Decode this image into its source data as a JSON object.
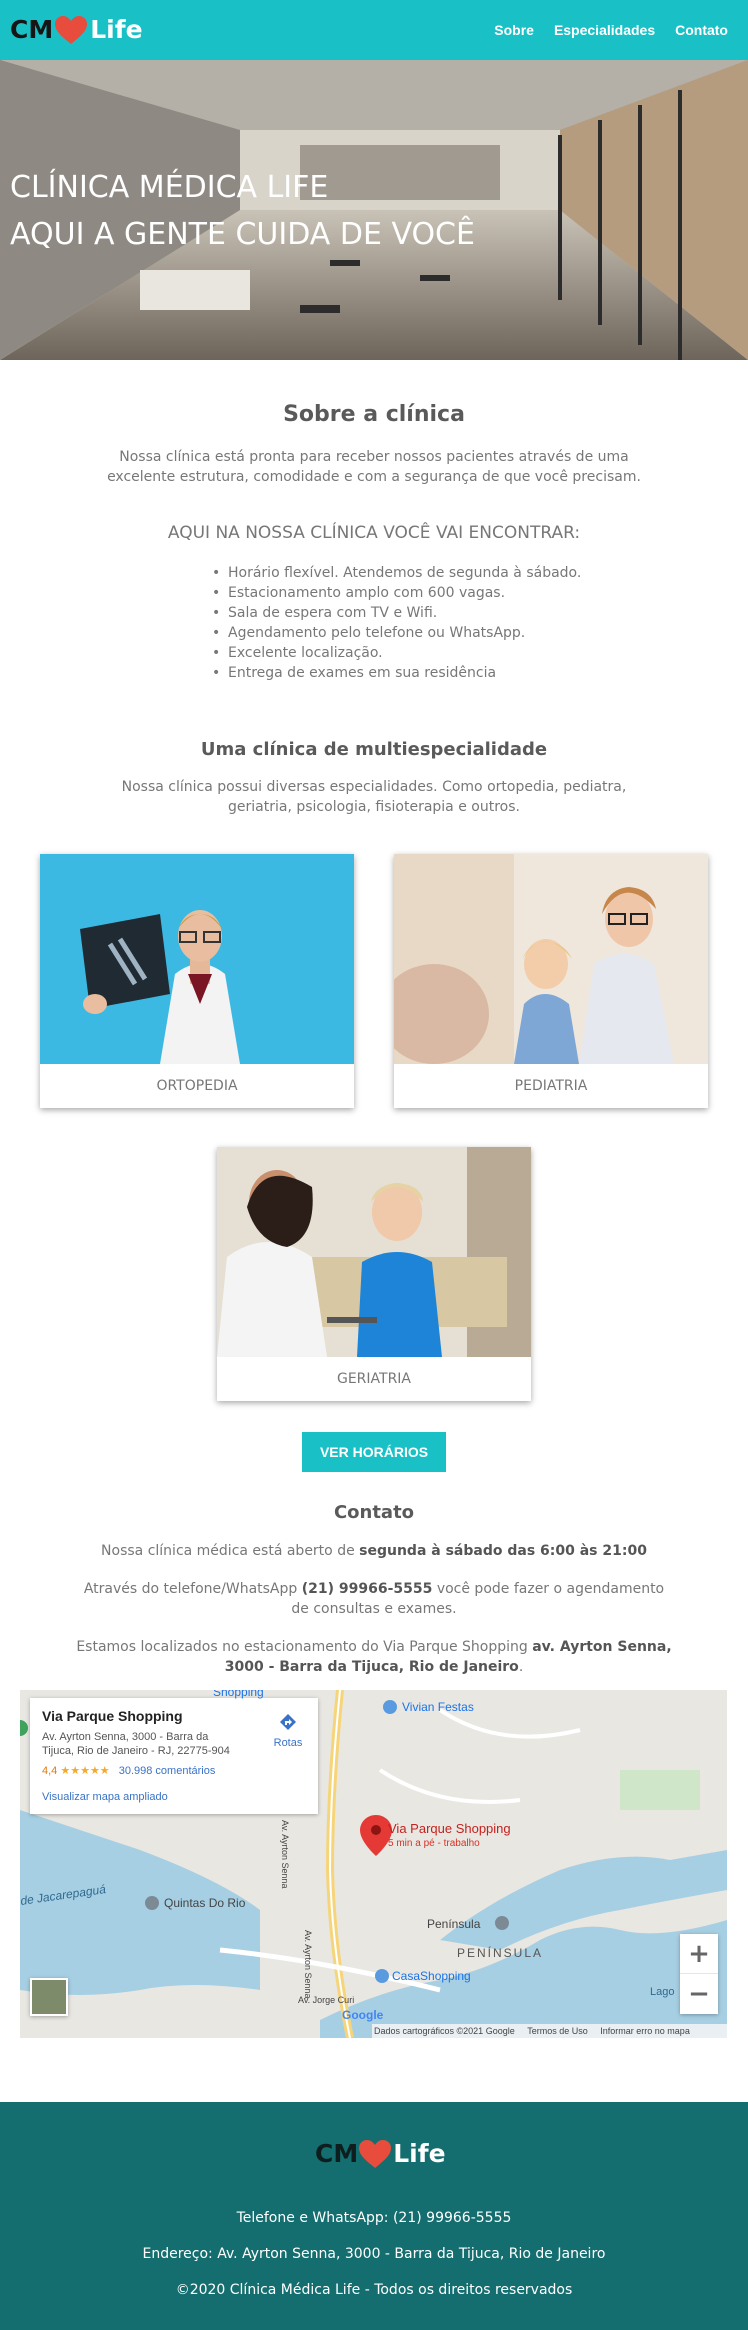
{
  "header": {
    "logo_cm": "CM",
    "logo_life": "Life",
    "nav": [
      "Sobre",
      "Especialidades",
      "Contato"
    ]
  },
  "hero": {
    "line1": "CLÍNICA MÉDICA LIFE",
    "line2": "AQUI A GENTE CUIDA DE VOCÊ"
  },
  "about": {
    "title": "Sobre a clínica",
    "text": "Nossa clínica está pronta para receber nossos pacientes através de uma excelente estrutura, comodidade e com a segurança de que você precisam.",
    "subtitle": "AQUI NA NOSSA CLÍNICA VOCÊ VAI ENCONTRAR:",
    "features": [
      "Horário flexível. Atendemos de segunda à sábado.",
      "Estacionamento amplo com 600 vagas.",
      "Sala de espera com TV e Wifi.",
      "Agendamento pelo telefone ou WhatsApp.",
      "Excelente localização.",
      "Entrega de exames em sua residência"
    ]
  },
  "specialties": {
    "title": "Uma clínica de multiespecialidade",
    "text": "Nossa clínica possui diversas especialidades. Como ortopedia, pediatra, geriatria, psicologia, fisioterapia e outros.",
    "cards": [
      "ORTOPEDIA",
      "PEDIATRIA",
      "GERIATRIA"
    ],
    "button": "VER HORÁRIOS"
  },
  "contact": {
    "title": "Contato",
    "hours_prefix": "Nossa clínica médica está aberto de ",
    "hours_bold": "segunda à sábado das 6:00 às 21:00",
    "phone_prefix": "Através do telefone/WhatsApp ",
    "phone_bold": "(21) 99966-5555",
    "phone_suffix": " você pode fazer o agendamento de consultas e exames.",
    "address_prefix": "Estamos localizados no estacionamento do Via Parque Shopping ",
    "address_bold": "av. Ayrton Senna, 3000 - Barra da Tijuca, Rio de Janeiro",
    "address_suffix": "."
  },
  "map": {
    "place_name": "Via Parque Shopping",
    "place_address": "Av. Ayrton Senna, 3000 - Barra da Tijuca, Rio de Janeiro - RJ, 22775-904",
    "rating": "4,4",
    "stars": "★★★★★",
    "reviews": "30.998 comentários",
    "directions": "Rotas",
    "expand_link": "Visualizar mapa ampliado",
    "pin_label": "Via Parque Shopping",
    "pin_sub": "5 min a pé - trabalho",
    "labels": {
      "shopping_top": "Shopping",
      "vivian": "Vivian Festas",
      "jacarepagua": "de Jacarepaguá",
      "quintas": "Quintas Do Rio",
      "peninsula1": "Península",
      "peninsula2": "PENÍNSULA",
      "casashopping": "CasaShopping",
      "road1": "Av. Ayrton Senna",
      "road2": "Av. Ayrton Senna",
      "jorge": "Av. Jorge Curi",
      "lago": "Lago",
      "google": "Google"
    },
    "attribution": [
      "Dados cartográficos ©2021 Google",
      "Termos de Uso",
      "Informar erro no mapa"
    ],
    "zoom_in": "+",
    "zoom_out": "−",
    "colors": {
      "pin": "#e53935",
      "water": "#a7cfe3",
      "land": "#e9e7e2"
    }
  },
  "footer": {
    "logo_cm": "CM",
    "logo_life": "Life",
    "phone": "Telefone e WhatsApp: (21) 99966-5555",
    "address": "Endereço: Av. Ayrton Senna, 3000 - Barra da Tijuca, Rio de Janeiro",
    "copyright": "©2020 Clínica Médica Life - Todos os direitos reservados"
  },
  "colors": {
    "brand": "#19c1c6",
    "footer": "#146d6e",
    "heart": "#e74c3c"
  }
}
